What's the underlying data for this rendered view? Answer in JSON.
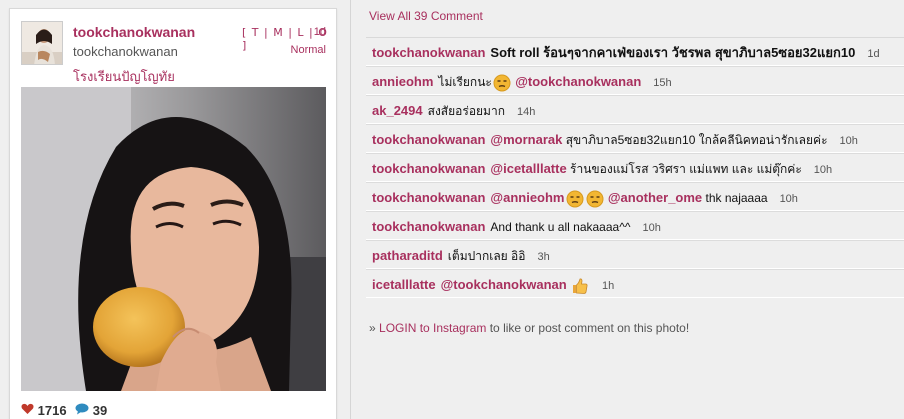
{
  "post": {
    "username": "tookchanokwanan",
    "fullname": "tookchanokwanan",
    "location": "โรงเรียนปัญโญทัย",
    "nav_links": "[ T | M | L | O ]",
    "age": "1d",
    "filter": "Normal",
    "likes": "1716",
    "comment_count": "39",
    "colors": {
      "accent": "#a8305e",
      "heart": "#c0392b",
      "bubble": "#2f8bbf"
    }
  },
  "view_all": "View All 39 Comment",
  "comments": [
    {
      "user": "tookchanokwanan",
      "text": "Soft roll ร้อนๆจากคาเฟ่ของเรา วัชรพล สุขาภิบาล5ซอย32แยก10",
      "time": "1d"
    },
    {
      "user": "annieohm",
      "text": "ไม่เรียกนะ",
      "emoji": "unamused-face-icon",
      "mention": "@tookchanokwanan",
      "time": "15h"
    },
    {
      "user": "ak_2494",
      "text": "สงสัยอร่อยมาก",
      "time": "14h"
    },
    {
      "user": "tookchanokwanan",
      "mention": "@mornarak",
      "text": "สุขาภิบาล5ซอย32แยก10 ใกล้คลีนิคทอน่ารักเลยค่ะ",
      "time": "10h"
    },
    {
      "user": "tookchanokwanan",
      "mention": "@icetalllatte",
      "text": "ร้านของแม่โรส วริศรา แม่แพท และ แม่ตุ๊กค่ะ",
      "time": "10h"
    },
    {
      "user": "tookchanokwanan",
      "mention": "@annieohm",
      "emoji": "unamused-face-icon",
      "mention2": "@another_ome",
      "text": "thk najaaaa",
      "time": "10h"
    },
    {
      "user": "tookchanokwanan",
      "text": "And thank u all nakaaaa^^",
      "time": "10h"
    },
    {
      "user": "patharaditd",
      "text": "เต็มปากเลย อิอิ",
      "time": "3h"
    },
    {
      "user": "icetalllatte",
      "mention": "@tookchanokwanan",
      "emoji": "thumbs-up-icon",
      "time": "1h"
    }
  ],
  "login": {
    "prefix": "» ",
    "link": "LOGIN to Instagram",
    "suffix": " to like or post comment on this photo!"
  }
}
